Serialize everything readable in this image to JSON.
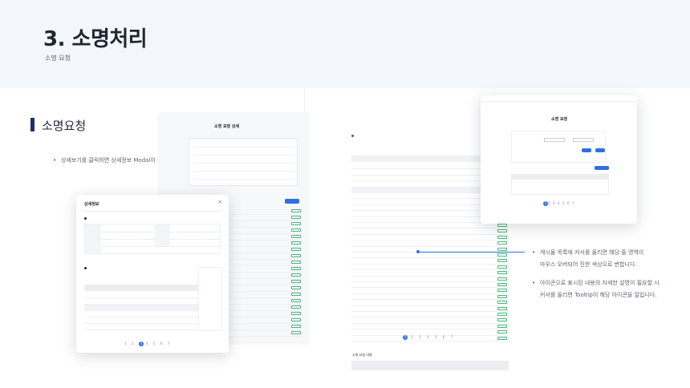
{
  "header": {
    "title": "3. 소명처리",
    "subtitle": "소명 요청"
  },
  "section": {
    "title": "소명요청",
    "left_bullet": "상세보기를 클릭하면 상세정보 Modal이 뜹니다.",
    "right_bullets": [
      "게시물 목록에 커서를 올리면 해당 줄 영역이",
      "마우스 오버되어 진한 색상으로 변합니다.",
      "아이콘으로 표시된 내용의 자세한 설명이 필요할 시",
      "커서를 올리면 Tooltip이 해당 아이콘을 알립니다."
    ]
  },
  "modal": {
    "title": "상세정보",
    "close": "×",
    "pages": [
      "1",
      "2",
      "3",
      "4",
      "5",
      "6",
      "7"
    ],
    "active_page": "3"
  },
  "detail_window": {
    "title": "소명 요청 상세"
  },
  "overlay_window": {
    "title": "소명 요청"
  },
  "list": {
    "pages": [
      "1",
      "2",
      "3",
      "4",
      "5",
      "6",
      "7"
    ],
    "active_page": "1",
    "bottom_section": "소명 요청 내용"
  },
  "colors": {
    "accent": "#2f6fe0",
    "section_bar": "#1c2f6e",
    "header_band": "#f3f6fb",
    "status_tag": "#4ab37a"
  }
}
